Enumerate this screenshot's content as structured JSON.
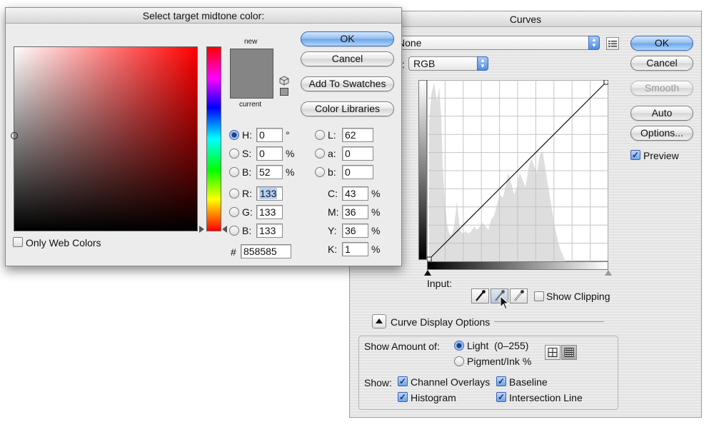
{
  "picker": {
    "title": "Select target midtone color:",
    "new_label": "new",
    "current_label": "current",
    "ok": "OK",
    "cancel": "Cancel",
    "add_swatches": "Add To Swatches",
    "color_libraries": "Color Libraries",
    "only_web_colors": "Only Web Colors",
    "swatch_color": "#858585",
    "fields": {
      "h": {
        "label": "H:",
        "value": "0",
        "unit": "°"
      },
      "s": {
        "label": "S:",
        "value": "0",
        "unit": "%"
      },
      "bri": {
        "label": "B:",
        "value": "52",
        "unit": "%"
      },
      "r": {
        "label": "R:",
        "value": "133"
      },
      "g": {
        "label": "G:",
        "value": "133"
      },
      "b": {
        "label": "B:",
        "value": "133"
      },
      "l": {
        "label": "L:",
        "value": "62"
      },
      "a": {
        "label": "a:",
        "value": "0"
      },
      "lab_b": {
        "label": "b:",
        "value": "0"
      },
      "c": {
        "label": "C:",
        "value": "43",
        "unit": "%"
      },
      "m": {
        "label": "M:",
        "value": "36",
        "unit": "%"
      },
      "y": {
        "label": "Y:",
        "value": "36",
        "unit": "%"
      },
      "k": {
        "label": "K:",
        "value": "1",
        "unit": "%"
      },
      "hex": {
        "label": "#",
        "value": "858585"
      }
    }
  },
  "curves": {
    "title": "Curves",
    "preset_value": "None",
    "channel_label": ":",
    "channel_value": "RGB",
    "ok": "OK",
    "cancel": "Cancel",
    "smooth": "Smooth",
    "auto": "Auto",
    "options": "Options...",
    "preview": "Preview",
    "input_label": "Input:",
    "show_clipping": "Show Clipping",
    "curve_display_options": "Curve Display Options",
    "show_amount_of": "Show Amount of:",
    "light": "Light  (0–255)",
    "pigment": "Pigment/Ink %",
    "show": "Show:",
    "channel_overlays": "Channel Overlays",
    "baseline": "Baseline",
    "histogram": "Histogram",
    "intersection_line": "Intersection Line"
  }
}
